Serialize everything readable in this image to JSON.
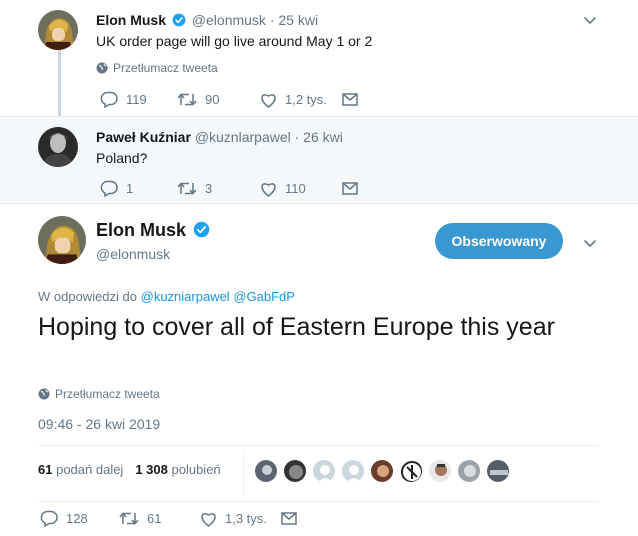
{
  "tweet1": {
    "name": "Elon Musk",
    "handle": "@elonmusk",
    "time": "· 25 kwi",
    "text": "UK order page will go live around May 1 or 2",
    "translate": "Przetłumacz tweeta",
    "replies": "119",
    "retweets": "90",
    "likes": "1,2 tys."
  },
  "tweet2": {
    "name": "Paweł Kuźniar",
    "handle": "@kuznlarpawel",
    "time": "· 26 kwi",
    "text": "Poland?",
    "replies": "1",
    "retweets": "3",
    "likes": "110"
  },
  "main": {
    "name": "Elon Musk",
    "handle": "@elonmusk",
    "follow_label": "Obserwowany",
    "reply_prefix": "W odpowiedzi do",
    "mention1": "@kuzniarpawel",
    "mention2": "@GabFdP",
    "text": "Hoping to cover all of Eastern Europe this year",
    "translate": "Przetłumacz tweeta",
    "timestamp": "09:46 - 26 kwi 2019",
    "retweet_count": "61",
    "retweet_label": "podań dalej",
    "like_count": "1 308",
    "like_label": "polubień",
    "replies": "128",
    "retweets": "61",
    "likes": "1,3 tys."
  },
  "colors": {
    "accent": "#1da1f2",
    "follow_button": "#3898cf",
    "muted": "#657786",
    "thread_line": "#ccd6dd"
  },
  "icons": [
    "verified-badge-icon",
    "globe-icon",
    "chevron-down-icon",
    "reply-icon",
    "retweet-icon",
    "like-icon",
    "message-icon"
  ]
}
